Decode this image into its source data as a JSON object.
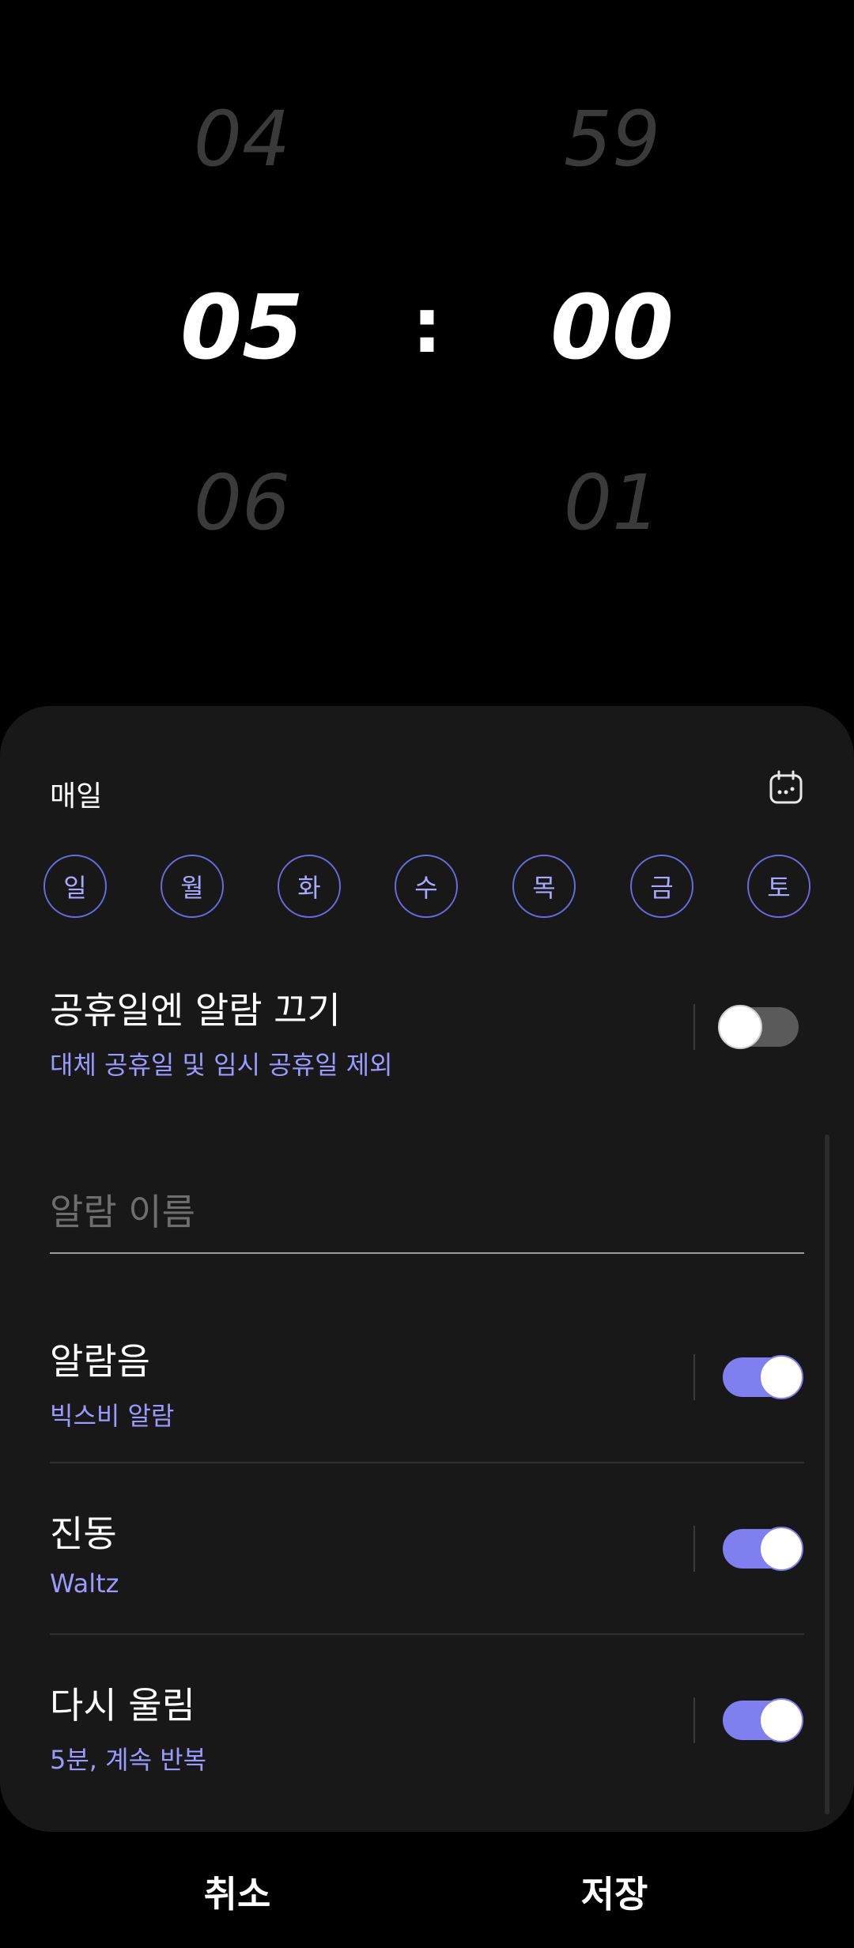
{
  "time_picker": {
    "hour_prev": "04",
    "hour": "05",
    "hour_next": "06",
    "separator": ":",
    "minute_prev": "59",
    "minute": "00",
    "minute_next": "01"
  },
  "repeat": {
    "label": "매일",
    "calendar_icon": "calendar-icon",
    "days": [
      "일",
      "월",
      "화",
      "수",
      "목",
      "금",
      "토"
    ]
  },
  "holiday": {
    "title": "공휴일엔 알람 끄기",
    "subtitle": "대체 공휴일 및 임시 공휴일 제외",
    "enabled": false
  },
  "alarm_name": {
    "placeholder": "알람 이름",
    "value": ""
  },
  "sound": {
    "title": "알람음",
    "subtitle": "빅스비 알람",
    "enabled": true
  },
  "vibration": {
    "title": "진동",
    "subtitle": "Waltz",
    "enabled": true
  },
  "snooze": {
    "title": "다시 울림",
    "subtitle": "5분, 계속 반복",
    "enabled": true
  },
  "actions": {
    "cancel": "취소",
    "save": "저장"
  },
  "colors": {
    "accent": "#7f7ff0",
    "card_bg": "#181818",
    "background": "#000000"
  }
}
